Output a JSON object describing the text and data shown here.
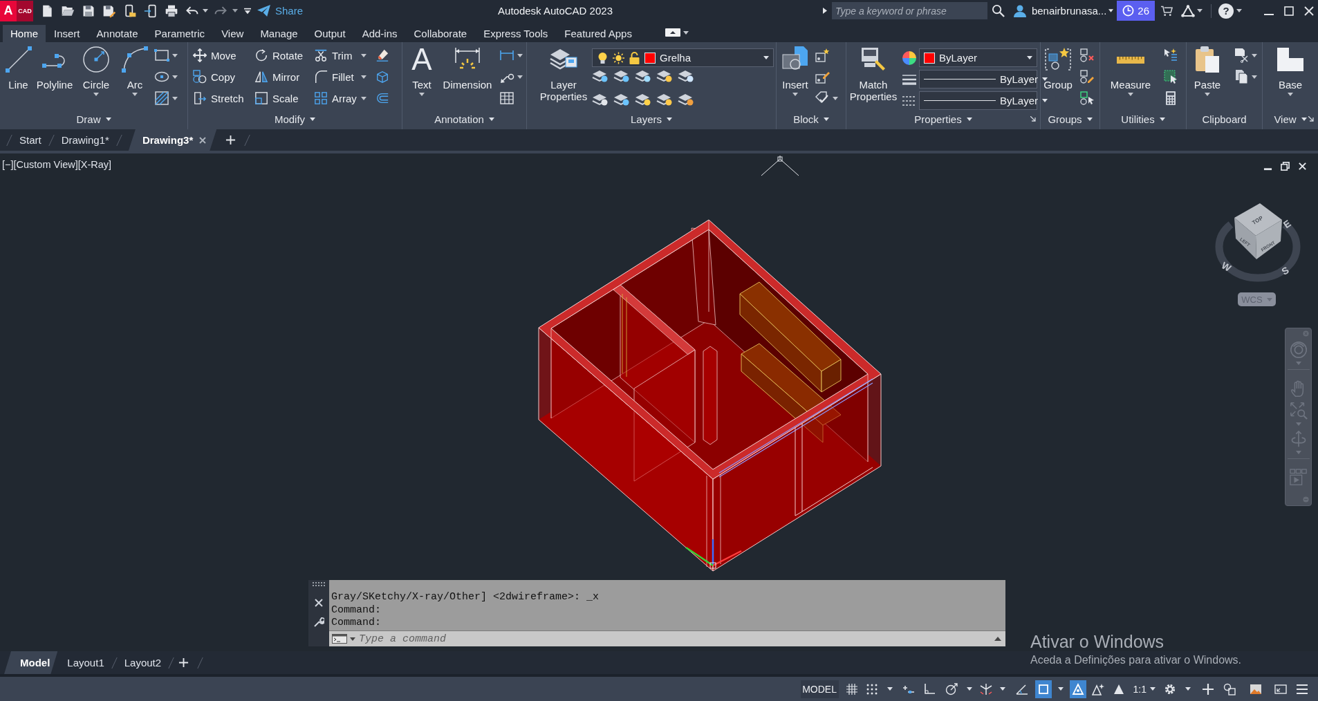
{
  "title_bar": {
    "logo_letter": "A",
    "logo_badge": "CAD",
    "share": "Share",
    "title": "Autodesk AutoCAD 2023",
    "search": {
      "placeholder": "Type a keyword or phrase"
    },
    "user": "benairbrunasa...",
    "clock_count": "26",
    "help": "?"
  },
  "ribbon_tabs": [
    {
      "label": "Home",
      "selected": true
    },
    {
      "label": "Insert",
      "selected": false
    },
    {
      "label": "Annotate",
      "selected": false
    },
    {
      "label": "Parametric",
      "selected": false
    },
    {
      "label": "View",
      "selected": false
    },
    {
      "label": "Manage",
      "selected": false
    },
    {
      "label": "Output",
      "selected": false
    },
    {
      "label": "Add-ins",
      "selected": false
    },
    {
      "label": "Collaborate",
      "selected": false
    },
    {
      "label": "Express Tools",
      "selected": false
    },
    {
      "label": "Featured Apps",
      "selected": false
    }
  ],
  "ribbon": {
    "draw": {
      "title": "Draw",
      "tools": [
        "Line",
        "Polyline",
        "Circle",
        "Arc"
      ]
    },
    "modify": {
      "title": "Modify",
      "tools": [
        "Move",
        "Rotate",
        "Trim",
        "Copy",
        "Mirror",
        "Fillet",
        "Stretch",
        "Scale",
        "Array"
      ]
    },
    "annotation": {
      "title": "Annotation",
      "text_glyph": "A",
      "tools": [
        "Text",
        "Dimension"
      ]
    },
    "layers": {
      "title": "Layers",
      "tool": "Layer Properties",
      "current_layer": "Grelha"
    },
    "block": {
      "title": "Block",
      "tool": "Insert"
    },
    "properties": {
      "title": "Properties",
      "tool": "Match Properties",
      "color_setting": "ByLayer",
      "lineweight": "ByLayer",
      "linetype": "ByLayer"
    },
    "groups": {
      "title": "Groups",
      "tool": "Group"
    },
    "utilities": {
      "title": "Utilities",
      "tool": "Measure"
    },
    "clipboard": {
      "title": "Clipboard",
      "tool": "Paste"
    },
    "view": {
      "title": "View",
      "tool": "Base"
    }
  },
  "file_tabs": [
    {
      "label": "Start",
      "selected": false
    },
    {
      "label": "Drawing1*",
      "selected": false
    },
    {
      "label": "Drawing3*",
      "selected": true
    }
  ],
  "viewport": {
    "label": "[−][Custom View][X-Ray]",
    "viewcube": {
      "top": "TOP",
      "left": "LEFT",
      "front": "FRONT",
      "west": "W",
      "east": "E",
      "south": "S",
      "coordinate_system": "WCS"
    }
  },
  "command_line": {
    "history": [
      "Gray/SKetchy/X-ray/Other] <2dwireframe>: _x",
      "Command:",
      "Command:"
    ],
    "placeholder": "Type a command"
  },
  "layout_tabs": [
    {
      "label": "Model",
      "selected": true
    },
    {
      "label": "Layout1",
      "selected": false
    },
    {
      "label": "Layout2",
      "selected": false
    }
  ],
  "status_bar": {
    "space": "MODEL",
    "annotation_scale": "1:1",
    "toggles": [
      {
        "on": false
      },
      {
        "on": false
      },
      {
        "on": false
      },
      {
        "on": false
      },
      {
        "on": false
      },
      {
        "on": false
      },
      {
        "on": false
      },
      {
        "on": true
      },
      {
        "on": true
      },
      {
        "on": false
      }
    ]
  },
  "activation_notice": {
    "title": "Ativar o Windows",
    "text": "Aceda a Definições para ativar o Windows."
  }
}
